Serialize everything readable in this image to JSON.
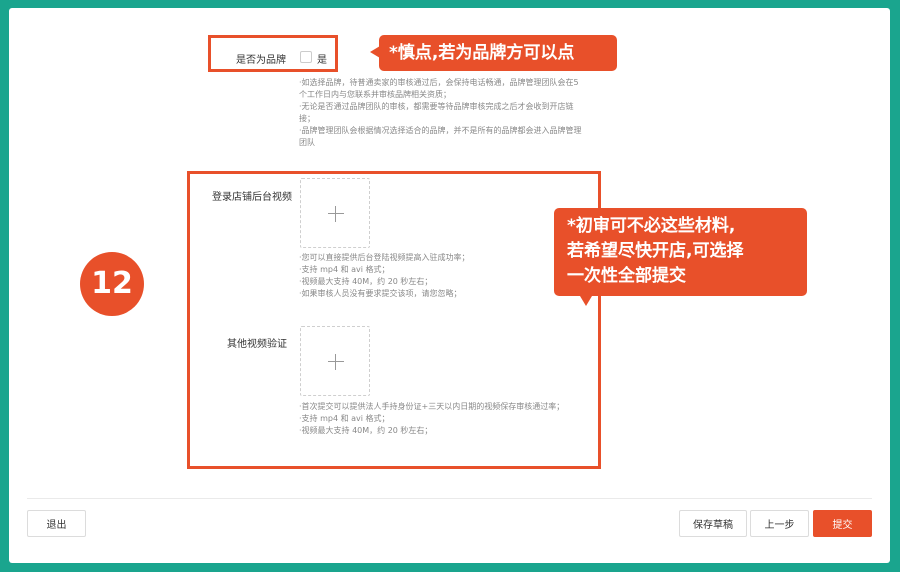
{
  "brand": {
    "label": "是否为品牌",
    "checkbox_label": "是",
    "notes": [
      "·如选择品牌，待普通卖家的审核通过后，会保持电话畅通，品牌管理团队会在5",
      "个工作日内与您联系并审核品牌相关资质；",
      "·无论是否通过品牌团队的审核，都需要等待品牌审核完成之后才会收到开店链",
      "接；",
      "·品牌管理团队会根据情况选择适合的品牌，并不是所有的品牌都会进入品牌管理",
      "团队"
    ]
  },
  "callouts": {
    "brand_tip": "*慎点,若为品牌方可以点",
    "materials_tip": [
      "*初审可不必这些材料,",
      "若希望尽快开店,可选择",
      "一次性全部提交"
    ]
  },
  "step_badge": "12",
  "video_store": {
    "label": "登录店铺后台视频",
    "notes": [
      "·您可以直接提供后台登陆视频提高入驻成功率；",
      "·支持 mp4 和 avi 格式；",
      "·视频最大支持 40M，约 20 秒左右；",
      "·如果审核人员没有要求提交该项，请您忽略；"
    ]
  },
  "video_other": {
    "label": "其他视频验证",
    "notes": [
      "·首次提交可以提供法人手持身份证+三天以内日期的视频保存审核通过率；",
      "·支持 mp4 和 avi 格式；",
      "·视频最大支持 40M，约 20 秒左右；"
    ]
  },
  "footer": {
    "exit": "退出",
    "save_draft": "保存草稿",
    "prev": "上一步",
    "submit": "提交"
  },
  "colors": {
    "accent": "#e8502a",
    "frame": "#1aa58e"
  }
}
